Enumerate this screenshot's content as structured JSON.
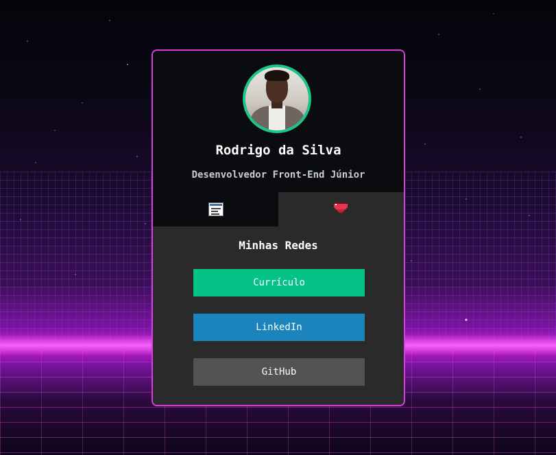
{
  "profile": {
    "name": "Rodrigo da Silva",
    "role": "Desenvolvedor Front-End Júnior"
  },
  "tabs": [
    {
      "icon": "document-icon"
    },
    {
      "icon": "heart-icon"
    }
  ],
  "section": {
    "title": "Minhas Redes"
  },
  "links": {
    "curriculo": "Currículo",
    "linkedin": "LinkedIn",
    "github": "GitHub"
  },
  "colors": {
    "card_border": "#d63fdc",
    "avatar_ring": "#1dc58a",
    "curriculo_button": "#05c386",
    "linkedin_button": "#1c84bd",
    "github_button": "#535353",
    "header_bg": "#0a0c10",
    "body_bg": "#2a2a2a"
  }
}
